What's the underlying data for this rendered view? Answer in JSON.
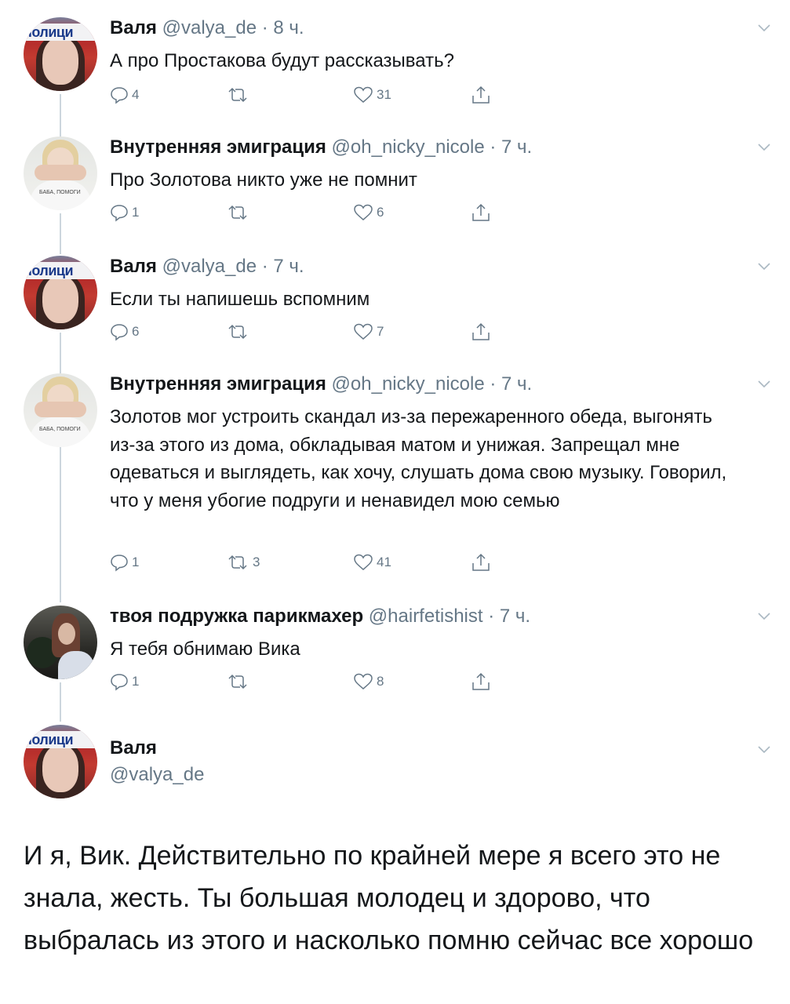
{
  "tweets": [
    {
      "name": "Валя",
      "handle": "@valya_de",
      "dot": "·",
      "time": "8 ч.",
      "text": "А про Простакова будут рассказывать?",
      "replies": "4",
      "retweets": "",
      "likes": "31",
      "avatar": "valya"
    },
    {
      "name": "Внутренняя эмиграция",
      "handle": "@oh_nicky_nicole",
      "dot": "·",
      "time": "7 ч.",
      "text": "Про Золотова никто уже не помнит",
      "replies": "1",
      "retweets": "",
      "likes": "6",
      "avatar": "nicky"
    },
    {
      "name": "Валя",
      "handle": "@valya_de",
      "dot": "·",
      "time": "7 ч.",
      "text": "Если ты напишешь вспомним",
      "replies": "6",
      "retweets": "",
      "likes": "7",
      "avatar": "valya"
    },
    {
      "name": "Внутренняя эмиграция",
      "handle": "@oh_nicky_nicole",
      "dot": "·",
      "time": "7 ч.",
      "text": "Золотов мог устроить скандал из-за пережаренного обеда, выгонять из-за этого из дома, обкладывая матом и унижая. Запрещал мне одеваться и выглядеть, как хочу, слушать дома свою музыку. Говорил, что у меня убогие подруги и ненавидел мою семью",
      "replies": "1",
      "retweets": "3",
      "likes": "41",
      "avatar": "nicky"
    },
    {
      "name": "твоя подружка парикмахер",
      "handle": "@hairfetishist",
      "dot": "·",
      "time": "7 ч.",
      "text": "Я тебя обнимаю Вика",
      "replies": "1",
      "retweets": "",
      "likes": "8",
      "avatar": "hair"
    }
  ],
  "main_tweet": {
    "name": "Валя",
    "handle": "@valya_de",
    "text": "И я, Вик. Действительно по крайней мере я всего это не знала, жесть. Ты большая молодец и здорово, что выбралась из этого и насколько помню сейчас все хорошо"
  },
  "avatar_labels": {
    "valya_banner": "полици",
    "nicky_caption": "БАБА, ПОМОГИ"
  },
  "colors": {
    "text": "#14171a",
    "secondary": "#657786",
    "thread_line": "#ccd6dd"
  },
  "icons": {
    "reply": "reply-icon",
    "retweet": "retweet-icon",
    "like": "heart-icon",
    "share": "share-icon",
    "caret": "chevron-down-icon"
  }
}
